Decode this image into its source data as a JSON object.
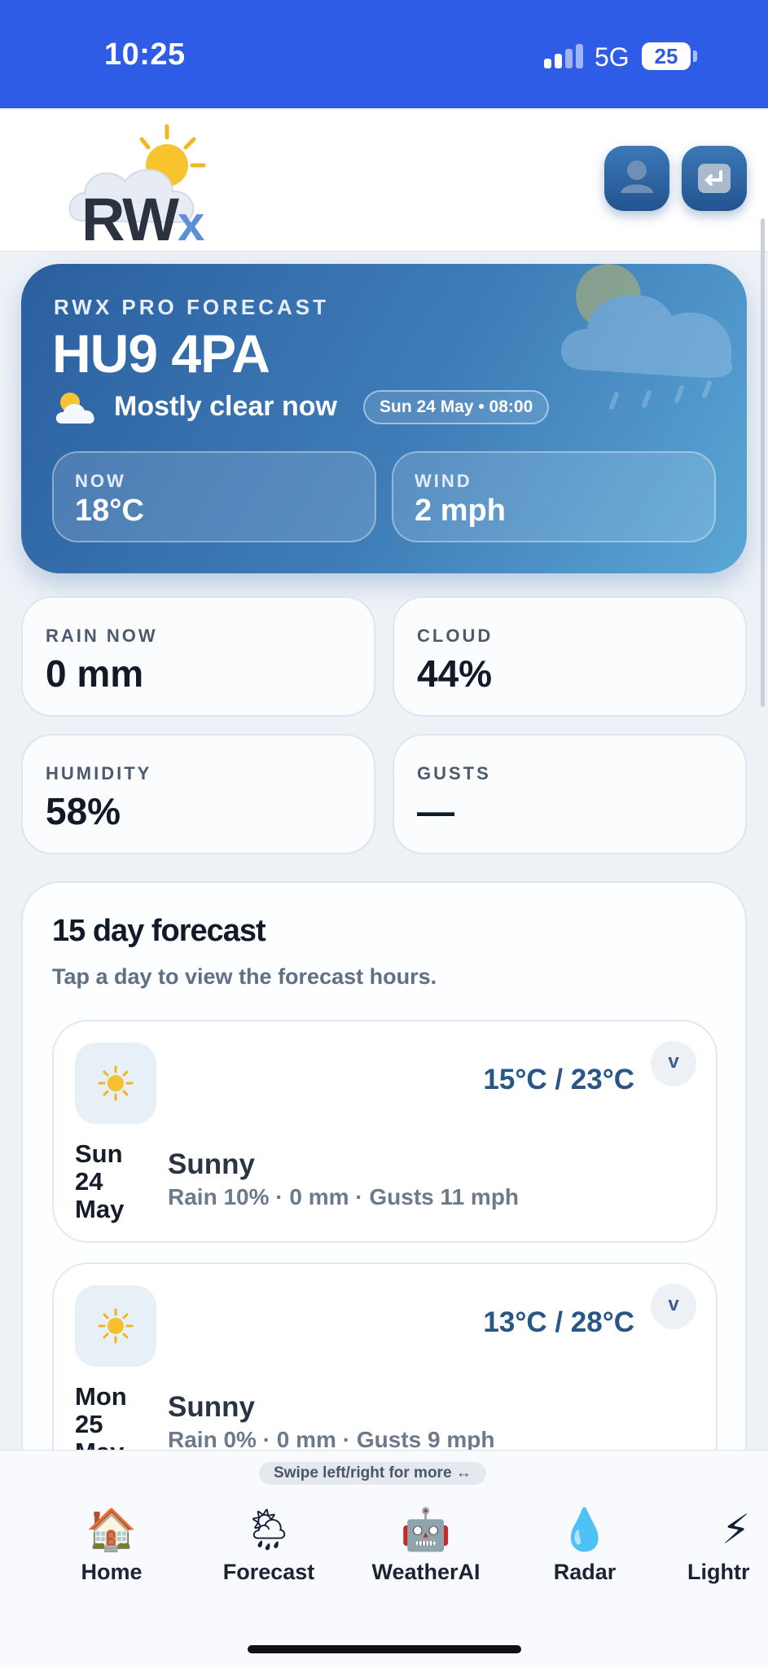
{
  "status_bar": {
    "time": "10:25",
    "network": "5G",
    "battery": "25",
    "accent_color": "#2f5ce6"
  },
  "header": {
    "logo_text": "RW",
    "logo_x": "x",
    "user_button_icon": "person-icon",
    "back_button_icon": "return-arrow-icon"
  },
  "hero": {
    "label": "RWX PRO FORECAST",
    "postcode": "HU9 4PA",
    "condition_icon": "sun-behind-cloud-icon",
    "condition": "Mostly clear now",
    "date": "Sun 24 May • 08:00",
    "now_label": "NOW",
    "now_value": "18°C",
    "wind_label": "WIND",
    "wind_value": "2 mph"
  },
  "stats": [
    {
      "label": "RAIN NOW",
      "value": "0 mm"
    },
    {
      "label": "CLOUD",
      "value": "44%"
    },
    {
      "label": "HUMIDITY",
      "value": "58%"
    },
    {
      "label": "GUSTS",
      "value": "—"
    }
  ],
  "forecast": {
    "title": "15 day forecast",
    "subtitle": "Tap a day to view the forecast hours.",
    "days": [
      {
        "icon": "sun-icon",
        "date_line1": "Sun",
        "date_line2": "24",
        "date_line3": "May",
        "temps": "15°C / 23°C",
        "condition": "Sunny",
        "details": "Rain 10% · 0 mm · Gusts 11 mph",
        "chevron": "v"
      },
      {
        "icon": "sun-icon",
        "date_line1": "Mon",
        "date_line2": "25",
        "date_line3": "May",
        "temps": "13°C / 28°C",
        "condition": "Sunny",
        "details": "Rain 0% · 0 mm · Gusts 9 mph",
        "chevron": "v"
      }
    ]
  },
  "tabbar": {
    "swipe_hint": "Swipe left/right for more ↔",
    "tabs": [
      {
        "label": "Home",
        "icon": "🏠"
      },
      {
        "label": "Forecast",
        "icon": "🌦"
      },
      {
        "label": "WeatherAI",
        "icon": "🤖"
      },
      {
        "label": "Radar",
        "icon": "💧"
      },
      {
        "label": "Lightr",
        "icon": "⚡"
      }
    ]
  }
}
